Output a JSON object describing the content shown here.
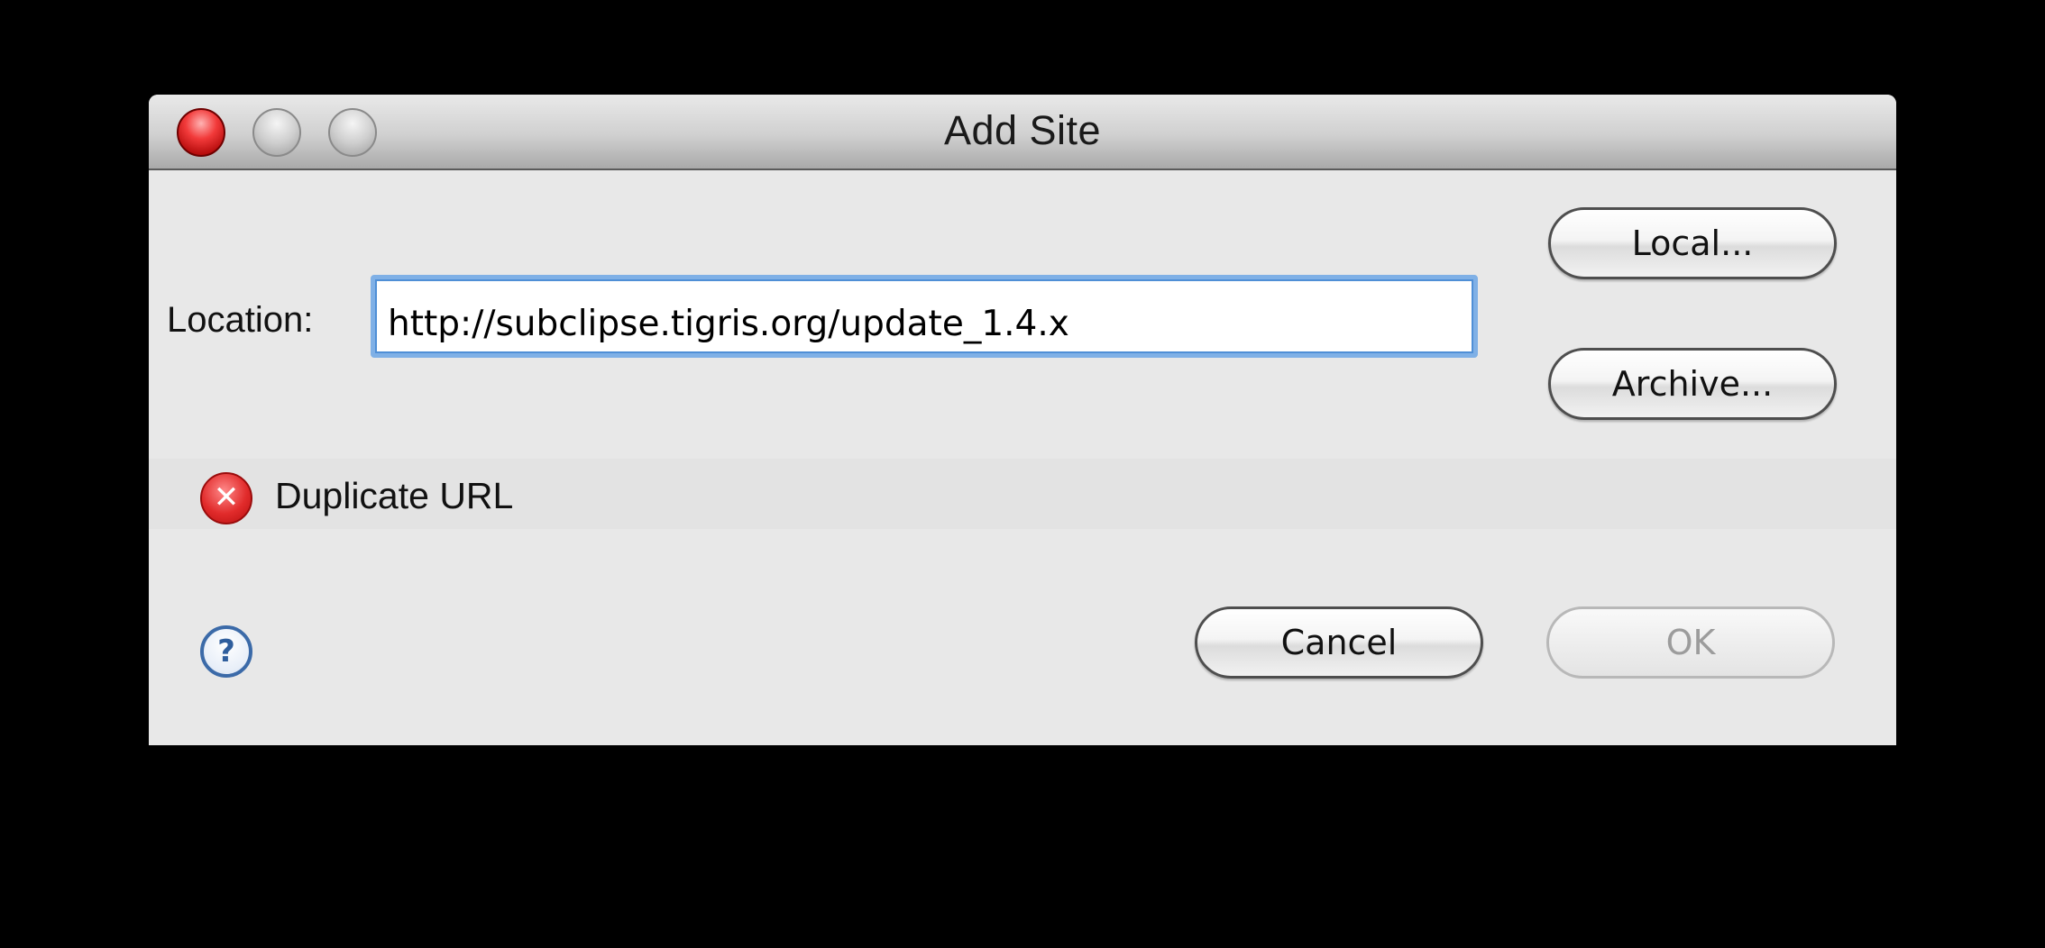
{
  "window": {
    "title": "Add Site",
    "controls": [
      "close-light",
      "minimize-light",
      "zoom-light"
    ]
  },
  "form": {
    "location_label": "Location:",
    "location_value": "http://subclipse.tigris.org/update_1.4.x"
  },
  "buttons": {
    "local": "Local...",
    "archive": "Archive...",
    "cancel": "Cancel",
    "ok": "OK"
  },
  "status": {
    "icon": "error-icon",
    "message": "Duplicate URL"
  },
  "help": {
    "icon": "help-icon",
    "glyph": "?"
  },
  "colors": {
    "focus_ring": "#7fb0e6",
    "error": "#e12b2b"
  }
}
